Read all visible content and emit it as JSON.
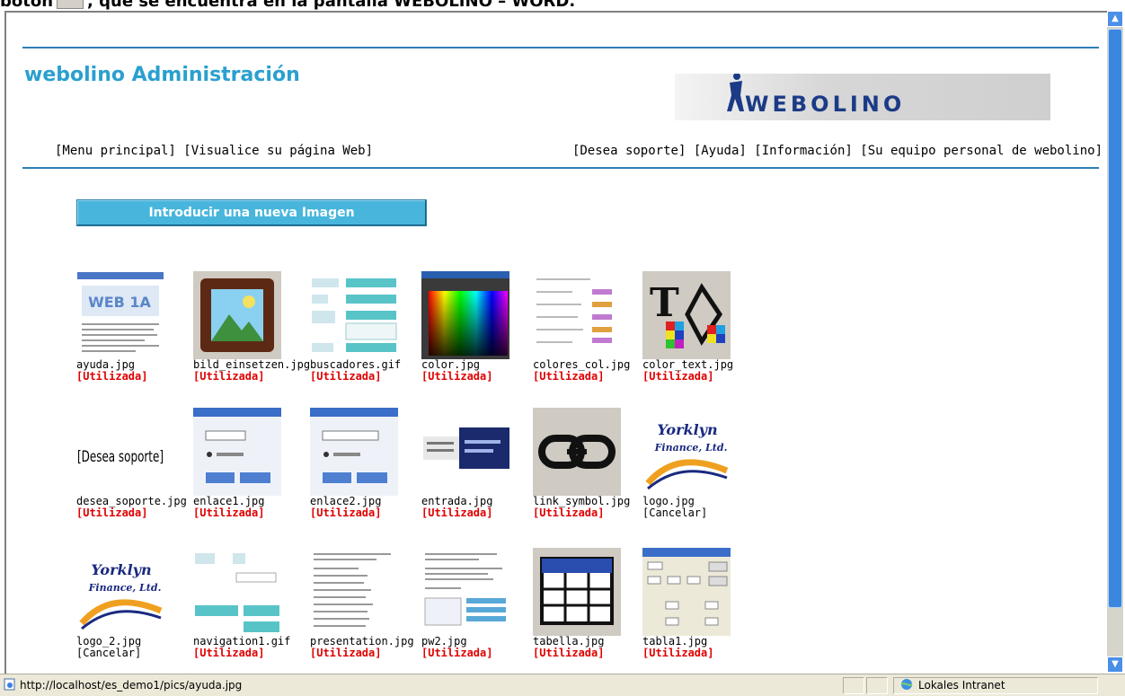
{
  "caption": {
    "before": "botón",
    "after": ", que se encuentra en la pantalla WEBOLINO – WORD."
  },
  "site_title": "webolino Administración",
  "logo_text": "WEBOLINO",
  "nav_left": [
    "[Menu principal]",
    "[Visualice su página Web]"
  ],
  "nav_right": [
    "[Desea soporte]",
    "[Ayuda]",
    "[Información]",
    "[Su equipo personal de webolino]"
  ],
  "new_image_button": "Introducir una nueva Imagen",
  "images": [
    {
      "file": "ayuda.jpg",
      "status": "[Utilizada]"
    },
    {
      "file": "bild_einsetzen.jpg",
      "status": "[Utilizada]"
    },
    {
      "file": "buscadores.gif",
      "status": "[Utilizada]"
    },
    {
      "file": "color.jpg",
      "status": "[Utilizada]"
    },
    {
      "file": "colores_col.jpg",
      "status": "[Utilizada]"
    },
    {
      "file": "color_text.jpg",
      "status": "[Utilizada]"
    },
    {
      "file": "desea_soporte.jpg",
      "status": "[Utilizada]"
    },
    {
      "file": "enlace1.jpg",
      "status": "[Utilizada]"
    },
    {
      "file": "enlace2.jpg",
      "status": "[Utilizada]"
    },
    {
      "file": "entrada.jpg",
      "status": "[Utilizada]"
    },
    {
      "file": "link_symbol.jpg",
      "status": "[Utilizada]"
    },
    {
      "file": "logo.jpg",
      "status": "[Cancelar]"
    },
    {
      "file": "logo_2.jpg",
      "status": "[Cancelar]"
    },
    {
      "file": "navigation1.gif",
      "status": "[Utilizada]"
    },
    {
      "file": "presentation.jpg",
      "status": "[Utilizada]"
    },
    {
      "file": "pw2.jpg",
      "status": "[Utilizada]"
    },
    {
      "file": "tabella.jpg",
      "status": "[Utilizada]"
    },
    {
      "file": "tabla1.jpg",
      "status": "[Utilizada]"
    }
  ],
  "thumb_text": {
    "web_logo": "WEB 1A",
    "desea": "[Desea soporte]",
    "brand_line1": "Yorklyn",
    "brand_line2": "Finance, Ltd."
  },
  "statusbar": {
    "url": "http://localhost/es_demo1/pics/ayuda.jpg",
    "zone": "Lokales Intranet"
  },
  "colors": {
    "accent": "#2aa0cf",
    "rule": "#2f7fb7",
    "used": "#e00000",
    "button": "#48b6dc"
  }
}
